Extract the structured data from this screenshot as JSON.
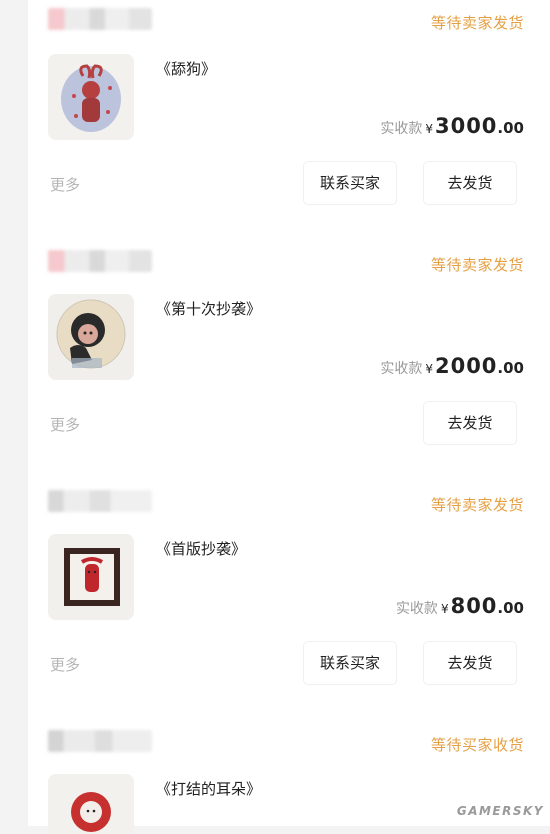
{
  "orders": [
    {
      "status": "等待卖家发货",
      "title": "《舔狗》",
      "price_label": "实收款",
      "currency": "¥",
      "price_int": "3000",
      "price_dec": ".00",
      "more": "更多",
      "buttons": [
        "联系买家",
        "去发货"
      ]
    },
    {
      "status": "等待卖家发货",
      "title": "《第十次抄袭》",
      "price_label": "实收款",
      "currency": "¥",
      "price_int": "2000",
      "price_dec": ".00",
      "more": "更多",
      "buttons": [
        "去发货"
      ]
    },
    {
      "status": "等待卖家发货",
      "title": "《首版抄袭》",
      "price_label": "实收款",
      "currency": "¥",
      "price_int": "800",
      "price_dec": ".00",
      "more": "更多",
      "buttons": [
        "联系买家",
        "去发货"
      ]
    },
    {
      "status": "等待买家收货",
      "title": "《打结的耳朵》"
    }
  ],
  "watermark": "GAMERSKY",
  "colors": {
    "status": "#e5a046",
    "page_bg": "#ffffff",
    "muted": "#b5b5b5"
  }
}
